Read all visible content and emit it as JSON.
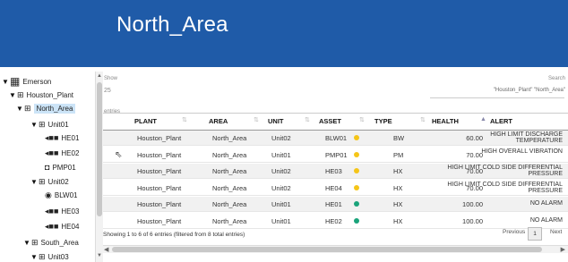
{
  "header": {
    "title": "North_Area",
    "bg_color": "#1f5ba8"
  },
  "tree": {
    "items": [
      {
        "label": "Emerson",
        "icon": "hierarchy-icon",
        "expanded": true
      },
      {
        "label": "Houston_Plant",
        "icon": "plant-icon",
        "expanded": true
      },
      {
        "label": "North_Area",
        "icon": "area-icon",
        "expanded": true,
        "selected": true
      },
      {
        "label": "Unit01",
        "icon": "unit-icon",
        "expanded": true
      },
      {
        "label": "HE01",
        "icon": "heat-exchanger-icon"
      },
      {
        "label": "HE02",
        "icon": "heat-exchanger-icon"
      },
      {
        "label": "PMP01",
        "icon": "pump-icon"
      },
      {
        "label": "Unit02",
        "icon": "unit-icon",
        "expanded": true
      },
      {
        "label": "BLW01",
        "icon": "blower-icon"
      },
      {
        "label": "HE03",
        "icon": "heat-exchanger-icon"
      },
      {
        "label": "HE04",
        "icon": "heat-exchanger-icon"
      },
      {
        "label": "South_Area",
        "icon": "area-icon",
        "expanded": true
      },
      {
        "label": "Unit03",
        "icon": "unit-icon",
        "expanded": true
      }
    ]
  },
  "table_controls": {
    "show_label": "Show",
    "show_value": "25",
    "entries_label": "entries",
    "search_label": "Search",
    "search_value": "\"Houston_Plant\" \"North_Area\""
  },
  "columns": [
    "PLANT",
    "AREA",
    "UNIT",
    "ASSET",
    "TYPE",
    "HEALTH",
    "ALERT"
  ],
  "rows": [
    {
      "plant": "Houston_Plant",
      "area": "North_Area",
      "unit": "Unit02",
      "asset": "BLW01",
      "status": "#f5c518",
      "type": "BW",
      "health": "60.00",
      "alert": "HIGH LIMIT DISCHARGE TEMPERATURE"
    },
    {
      "plant": "Houston_Plant",
      "area": "North_Area",
      "unit": "Unit01",
      "asset": "PMP01",
      "status": "#f5c518",
      "type": "PM",
      "health": "70.00",
      "alert": "HIGH OVERALL VIBRATION"
    },
    {
      "plant": "Houston_Plant",
      "area": "North_Area",
      "unit": "Unit02",
      "asset": "HE03",
      "status": "#f5c518",
      "type": "HX",
      "health": "70.00",
      "alert": "HIGH LIMIT COLD SIDE DIFFERENTIAL PRESSURE"
    },
    {
      "plant": "Houston_Plant",
      "area": "North_Area",
      "unit": "Unit02",
      "asset": "HE04",
      "status": "#f5c518",
      "type": "HX",
      "health": "70.00",
      "alert": "HIGH LIMIT COLD SIDE DIFFERENTIAL PRESSURE"
    },
    {
      "plant": "Houston_Plant",
      "area": "North_Area",
      "unit": "Unit01",
      "asset": "HE01",
      "status": "#1aa37a",
      "type": "HX",
      "health": "100.00",
      "alert": "NO ALARM"
    },
    {
      "plant": "Houston_Plant",
      "area": "North_Area",
      "unit": "Unit01",
      "asset": "HE02",
      "status": "#1aa37a",
      "type": "HX",
      "health": "100.00",
      "alert": "NO ALARM"
    }
  ],
  "footer": {
    "info": "Showing 1 to 6 of 6 entries (filtered from 8 total entries)",
    "previous": "Previous",
    "current_page": "1",
    "next": "Next"
  }
}
